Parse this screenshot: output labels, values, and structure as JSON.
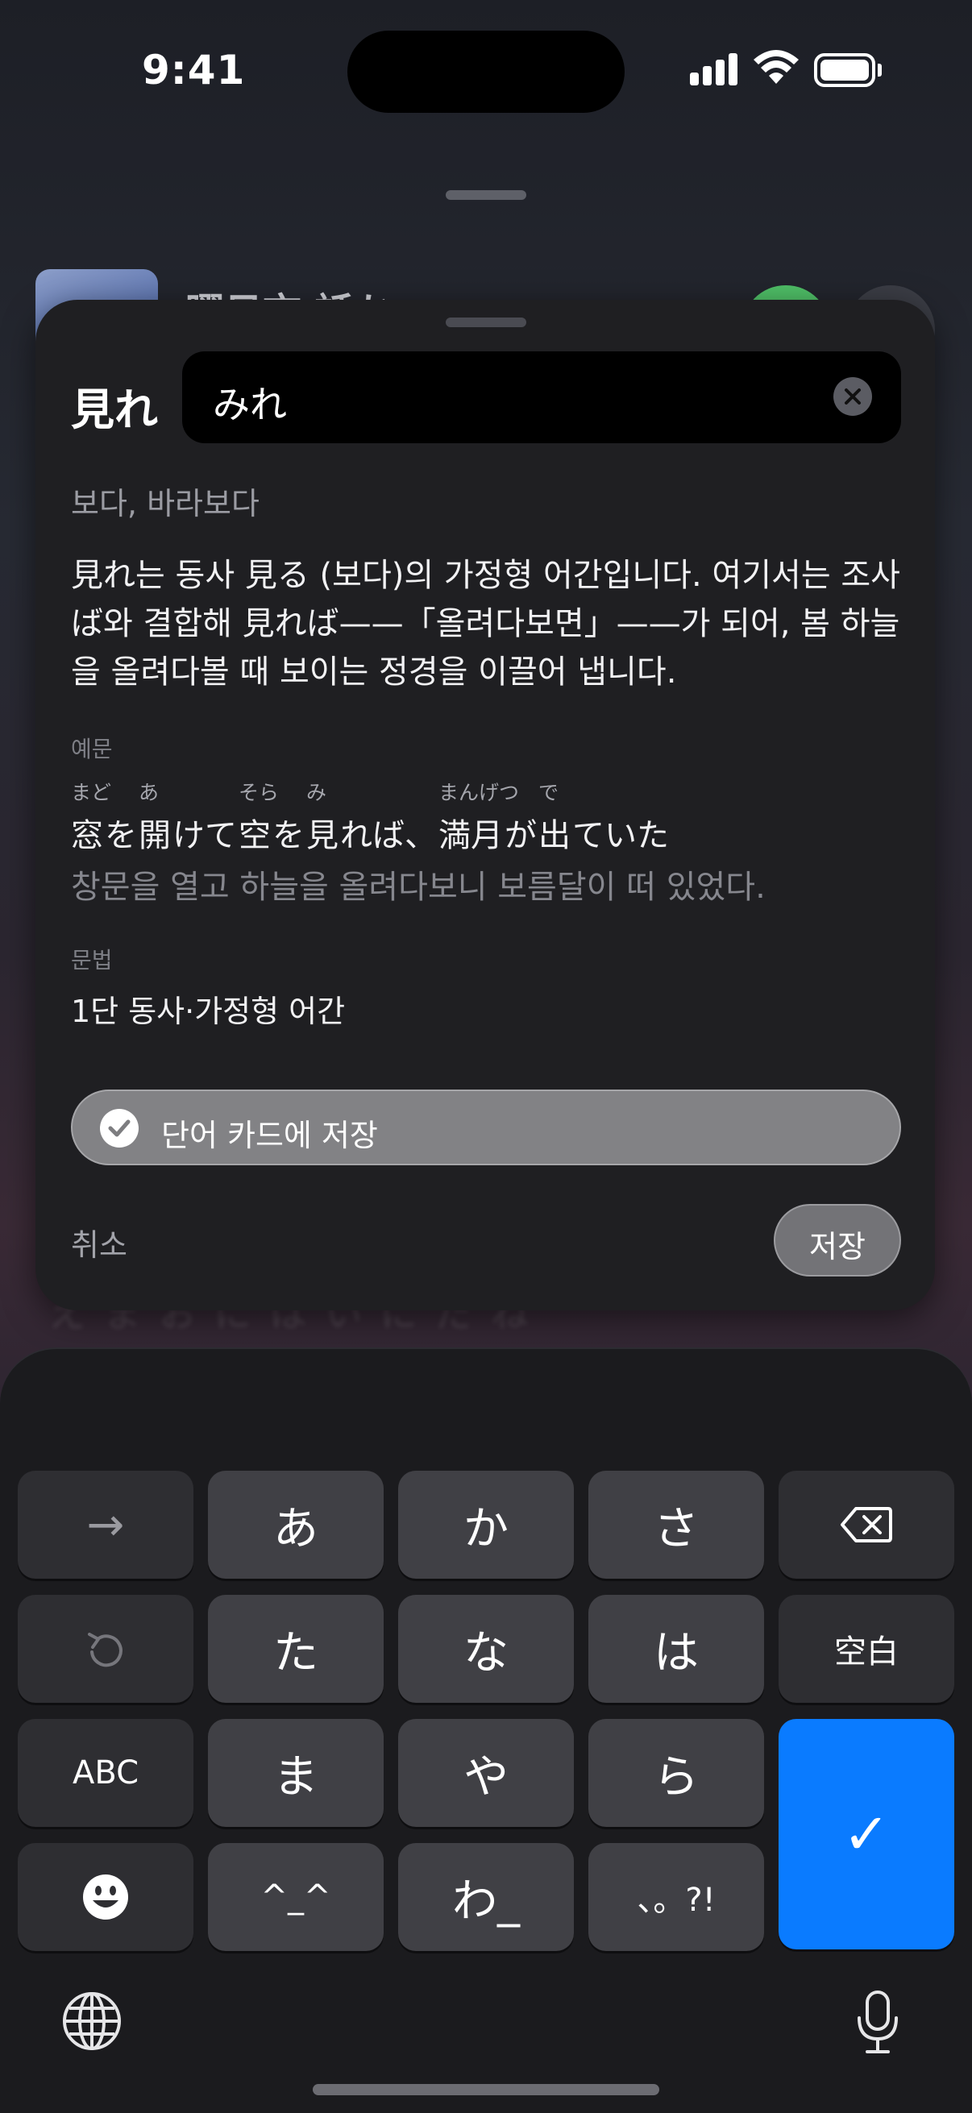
{
  "status_bar": {
    "time": "9:41"
  },
  "background_sheet": {
    "title": "曜日市 話か",
    "blur_text": "え ま お に は い に だ ね"
  },
  "card": {
    "word": "見れ",
    "search": {
      "value": "みれ"
    },
    "meaning": "보다, 바라보다",
    "explanation": "見れ는 동사 見る (보다)의 가정형 어간입니다. 여기서는 조사 ば와 결합해 見れば——「올려다보면」——가 되어, 봄 하늘을 올려다볼 때 보이는 정경을 이끌어 냅니다.",
    "example_label": "예문",
    "example": {
      "segments": [
        {
          "rb": "窓",
          "rt": "まど"
        },
        {
          "rb": "を",
          "rt": ""
        },
        {
          "rb": "開",
          "rt": "あ"
        },
        {
          "rb": "けて",
          "rt": ""
        },
        {
          "rb": "空",
          "rt": "そら"
        },
        {
          "rb": "を",
          "rt": ""
        },
        {
          "rb": "見",
          "rt": "み"
        },
        {
          "rb": "れば、",
          "rt": ""
        },
        {
          "rb": "満月",
          "rt": "まんげつ"
        },
        {
          "rb": "が",
          "rt": ""
        },
        {
          "rb": "出",
          "rt": "で"
        },
        {
          "rb": "ていた",
          "rt": ""
        }
      ],
      "translation": "창문을 열고 하늘을 올려다보니 보름달이 떠 있었다."
    },
    "grammar_label": "문법",
    "grammar": "1단 동사·가정형 어간",
    "save_toggle_label": "단어 카드에 저장",
    "cancel_label": "취소",
    "save_label": "저장"
  },
  "keyboard": {
    "keys": {
      "next": "→",
      "a": "あ",
      "ka": "か",
      "sa": "さ",
      "ta": "た",
      "na": "な",
      "ha": "は",
      "space": "空白",
      "abc": "ABC",
      "ma": "ま",
      "ya": "や",
      "ra": "ら",
      "kaomoji": "^_^",
      "wa": "わ_",
      "punct": "、。?!",
      "confirm": "✓"
    },
    "colors": {
      "confirm": "#0a7bff",
      "key": "#404045"
    }
  }
}
